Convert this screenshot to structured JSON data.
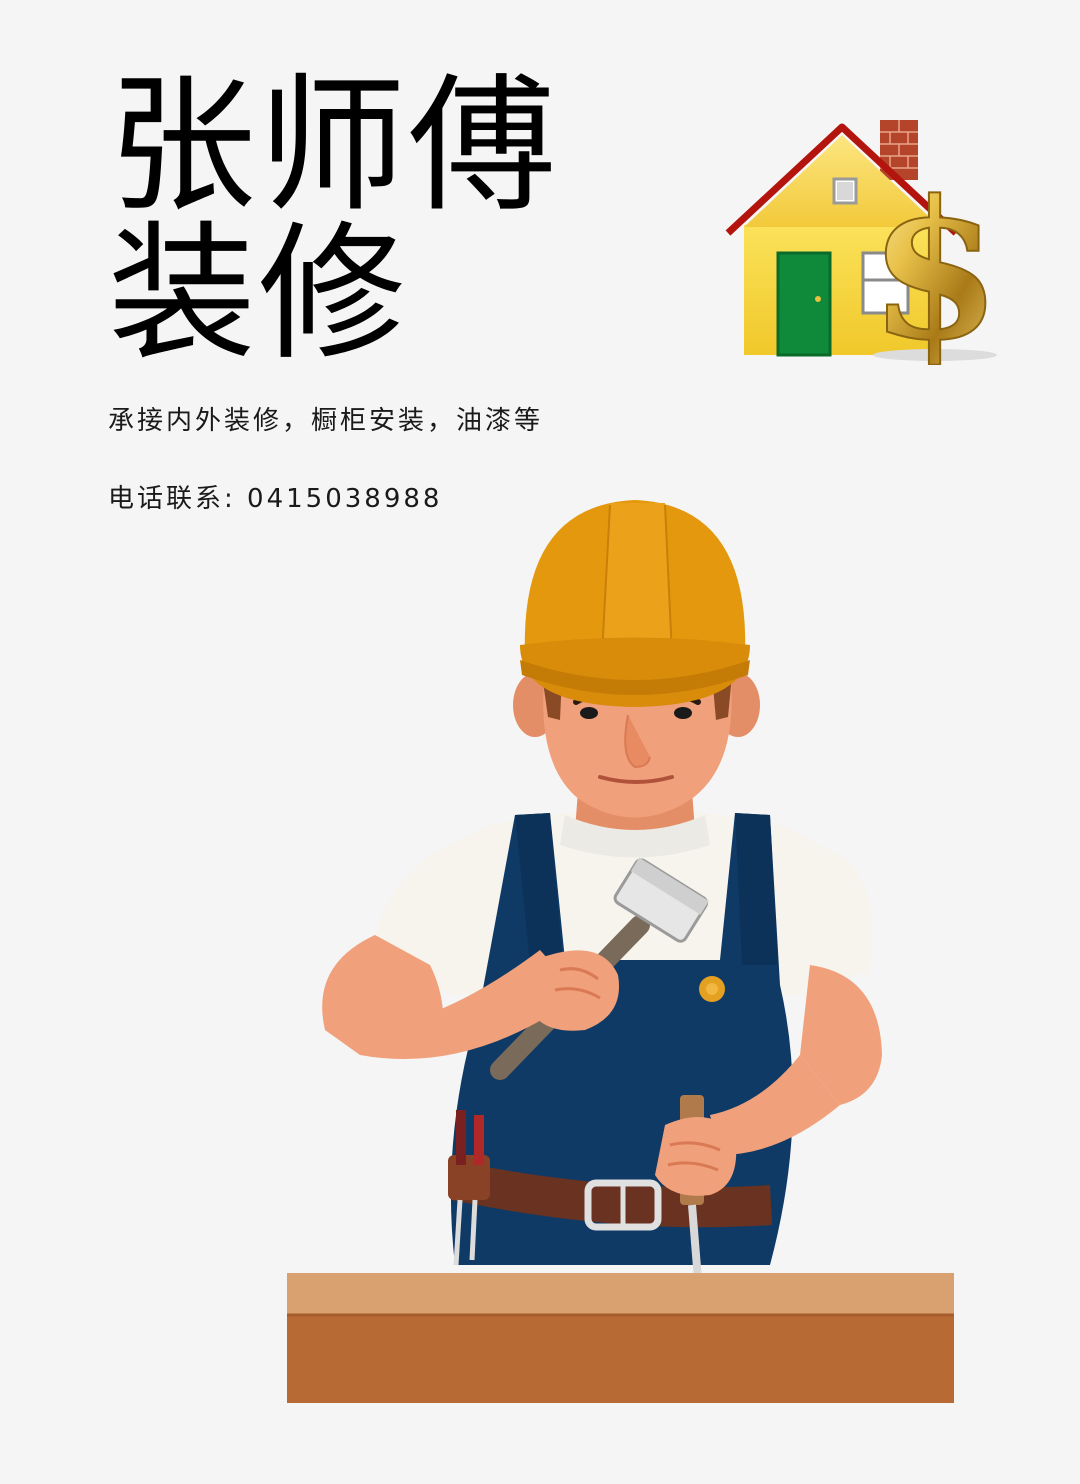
{
  "title": {
    "line1": "张师傅",
    "line2": "装修"
  },
  "services": {
    "text": "承接内外装修，橱柜安装，油漆等"
  },
  "contact": {
    "label": "电话联系:",
    "phone": "0415038988"
  },
  "icons": {
    "house": "house-dollar-icon",
    "worker": "carpenter-illustration"
  },
  "colors": {
    "background": "#f5f5f5",
    "helmet": "#e4980e",
    "overalls": "#0f3a66",
    "skin": "#f0a07a",
    "wood_top": "#d9a070",
    "wood_front": "#b86a35",
    "house_wall": "#f6d84a",
    "house_roof": "#c01a10",
    "house_door": "#0f8a3a",
    "dollar_gold": "#c8a030"
  }
}
